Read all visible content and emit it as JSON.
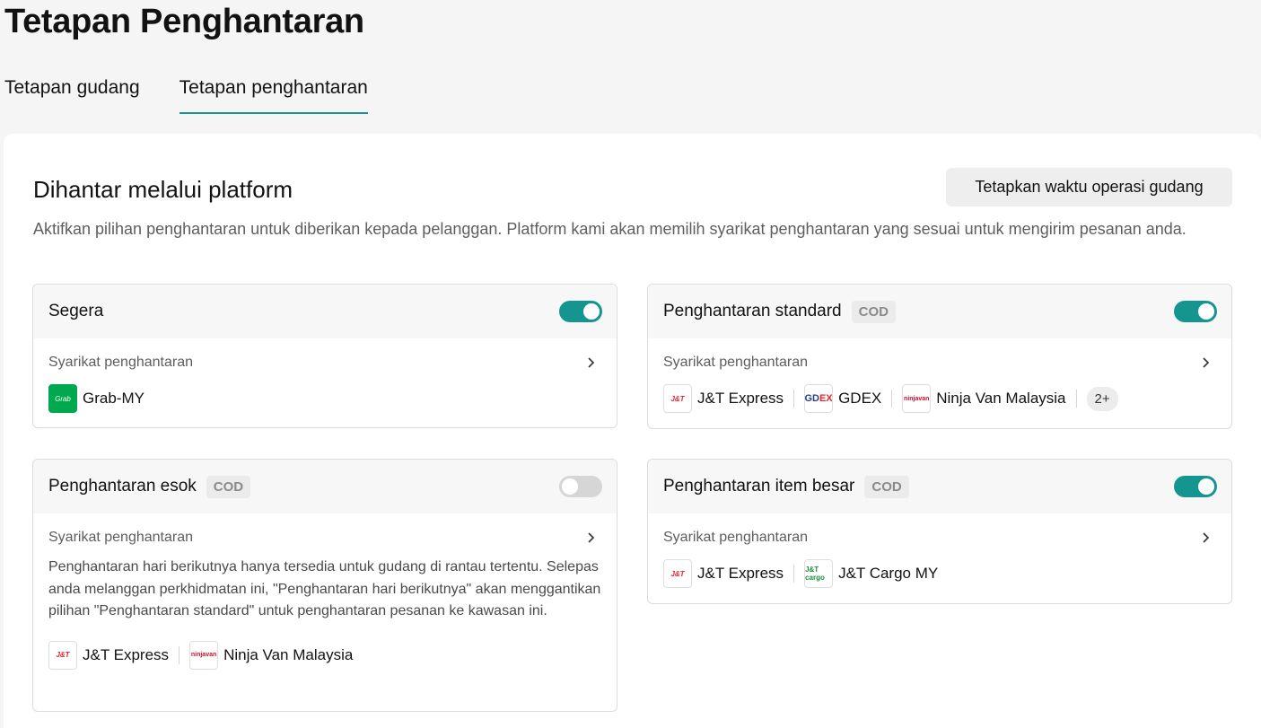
{
  "page": {
    "title": "Tetapan Penghantaran"
  },
  "tabs": [
    {
      "label": "Tetapan gudang",
      "active": false
    },
    {
      "label": "Tetapan penghantaran",
      "active": true
    }
  ],
  "section": {
    "title": "Dihantar melalui platform",
    "ops_button": "Tetapkan waktu operasi gudang",
    "description": "Aktifkan pilihan penghantaran untuk diberikan kepada pelanggan. Platform kami akan memilih syarikat penghantaran yang sesuai untuk mengirim pesanan anda."
  },
  "colors": {
    "accent": "#17908a",
    "toggle_on": "#149590",
    "toggle_off": "#d6d6d6"
  },
  "cards": {
    "segera": {
      "title": "Segera",
      "enabled": true,
      "carrier_label": "Syarikat penghantaran",
      "carriers": [
        {
          "name": "Grab-MY",
          "logo": "Grab"
        }
      ]
    },
    "standard": {
      "title": "Penghantaran standard",
      "badge": "COD",
      "enabled": true,
      "carrier_label": "Syarikat penghantaran",
      "carriers": [
        {
          "name": "J&T Express",
          "logo": "J&T"
        },
        {
          "name": "GDEX",
          "logo": "GD",
          "logo_suffix": "EX"
        },
        {
          "name": "Ninja Van Malaysia",
          "logo": "ninjavan"
        }
      ],
      "more": "2+"
    },
    "esok": {
      "title": "Penghantaran esok",
      "badge": "COD",
      "enabled": false,
      "carrier_label": "Syarikat penghantaran",
      "note": "Penghantaran hari berikutnya hanya tersedia untuk gudang di rantau tertentu. Selepas anda melanggan perkhidmatan ini, \"Penghantaran hari berikutnya\" akan menggantikan pilihan \"Penghantaran standard\" untuk penghantaran pesanan ke kawasan ini.",
      "carriers": [
        {
          "name": "J&T Express",
          "logo": "J&T"
        },
        {
          "name": "Ninja Van Malaysia",
          "logo": "ninjavan"
        }
      ]
    },
    "besar": {
      "title": "Penghantaran item besar",
      "badge": "COD",
      "enabled": true,
      "carrier_label": "Syarikat penghantaran",
      "carriers": [
        {
          "name": "J&T Express",
          "logo": "J&T"
        },
        {
          "name": "J&T Cargo MY",
          "logo": "J&T cargo"
        }
      ]
    }
  }
}
